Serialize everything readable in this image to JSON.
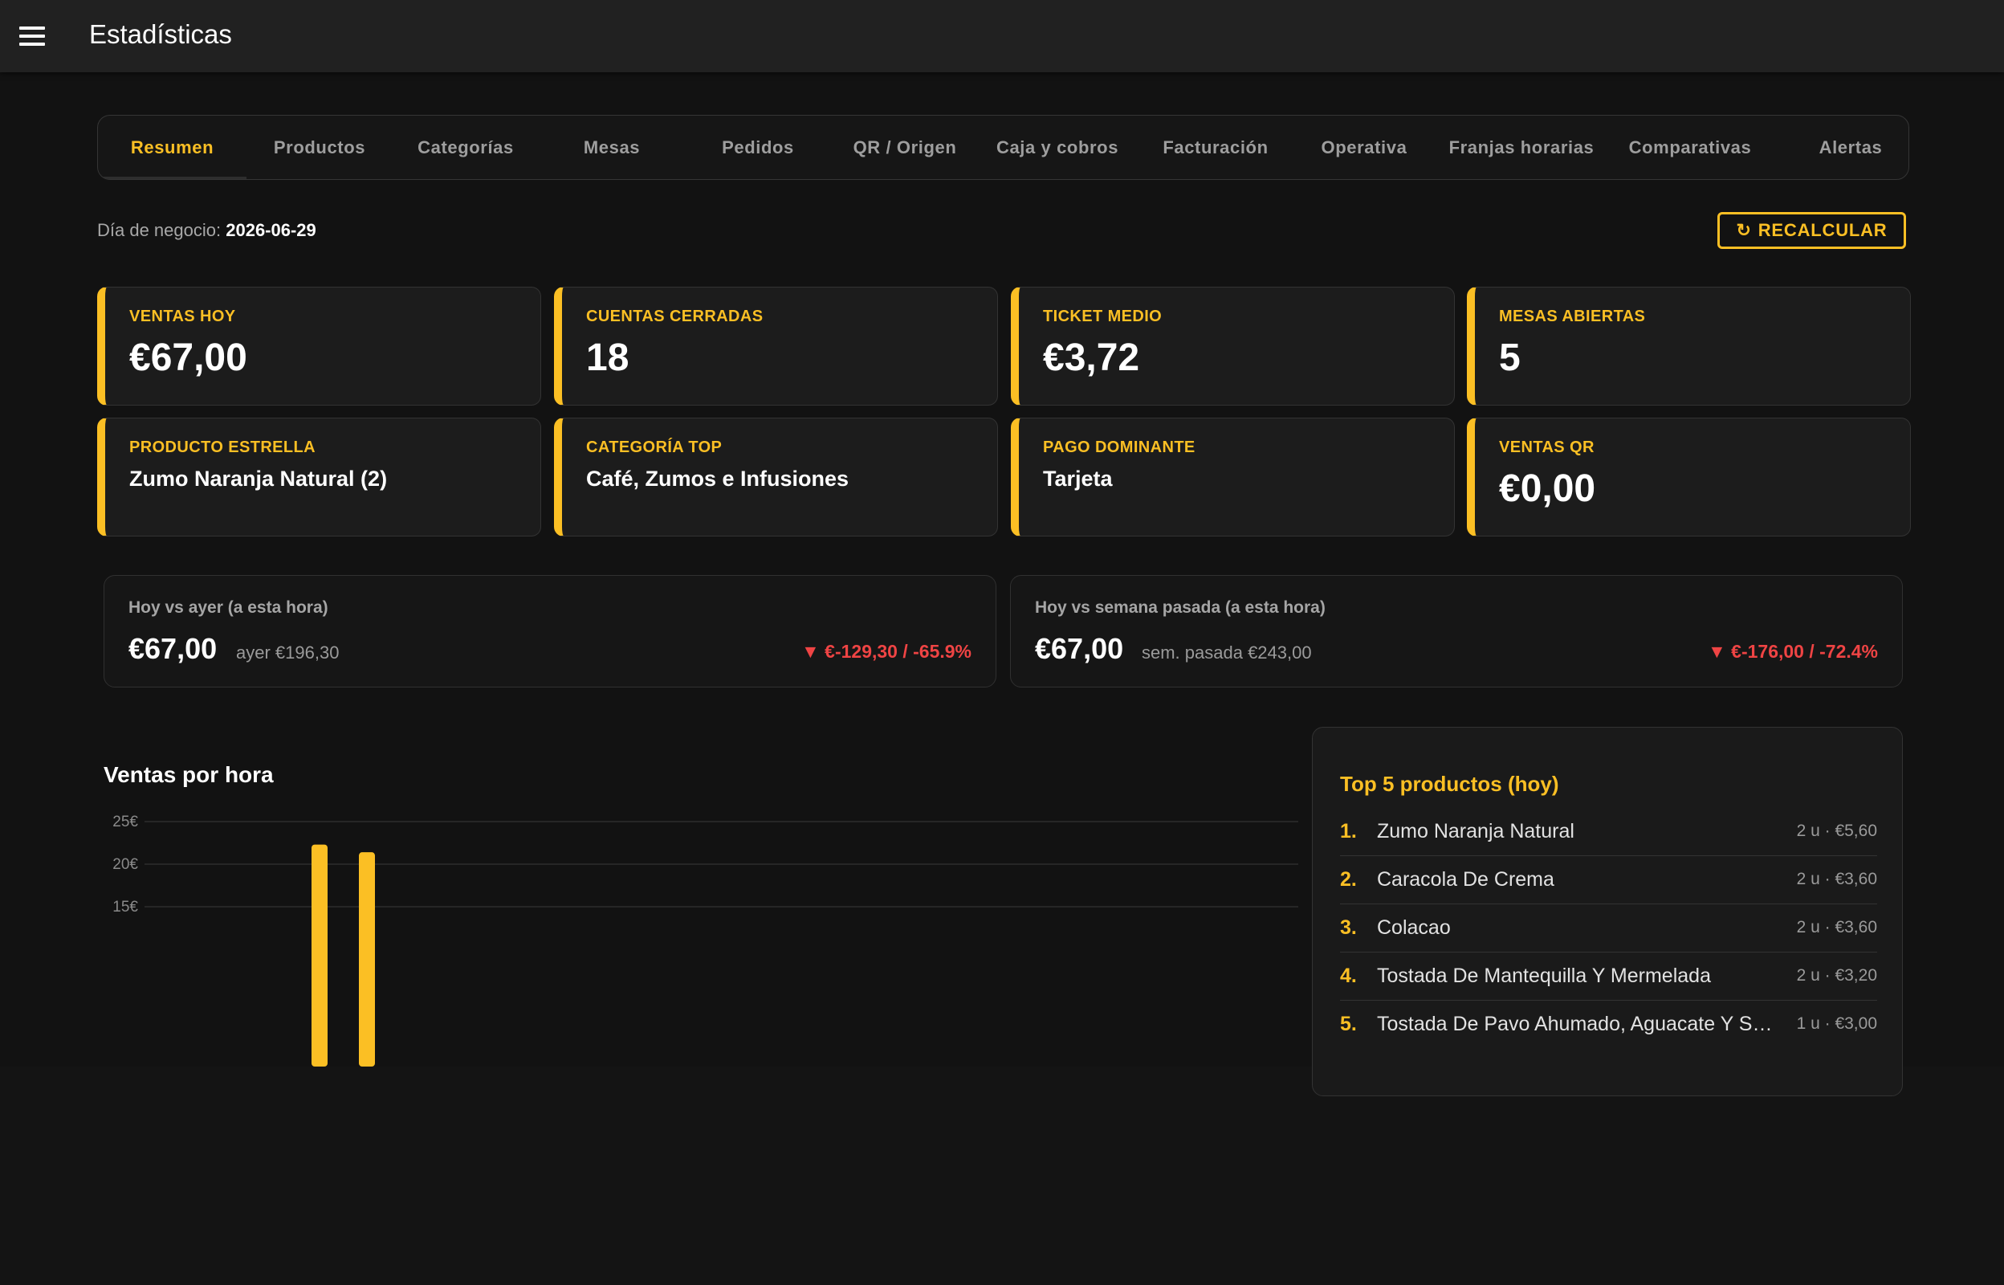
{
  "app": {
    "title": "Estadísticas"
  },
  "tabs": [
    {
      "label": "Resumen",
      "active": true
    },
    {
      "label": "Productos"
    },
    {
      "label": "Categorías"
    },
    {
      "label": "Mesas"
    },
    {
      "label": "Pedidos"
    },
    {
      "label": "QR / Origen"
    },
    {
      "label": "Caja y cobros"
    },
    {
      "label": "Facturación"
    },
    {
      "label": "Operativa"
    },
    {
      "label": "Franjas horarias"
    },
    {
      "label": "Comparativas"
    },
    {
      "label": "Alertas"
    }
  ],
  "business_day": {
    "label": "Día de negocio:",
    "value": "2026-06-29"
  },
  "recalc": {
    "icon": "refresh-icon",
    "glyph": "↻",
    "label": "RECALCULAR"
  },
  "kpis": [
    {
      "label": "VENTAS HOY",
      "value": "€67,00"
    },
    {
      "label": "CUENTAS CERRADAS",
      "value": "18"
    },
    {
      "label": "TICKET MEDIO",
      "value": "€3,72"
    },
    {
      "label": "MESAS ABIERTAS",
      "value": "5"
    },
    {
      "label": "PRODUCTO ESTRELLA",
      "value": "Zumo Naranja Natural (2)"
    },
    {
      "label": "CATEGORÍA TOP",
      "value": "Café, Zumos e Infusiones"
    },
    {
      "label": "PAGO DOMINANTE",
      "value": "Tarjeta"
    },
    {
      "label": "VENTAS QR",
      "value": "€0,00"
    }
  ],
  "comparisons": [
    {
      "label": "Hoy vs ayer (a esta hora)",
      "now": "€67,00",
      "prev": "ayer €196,30",
      "delta": "▼ €-129,30 / -65.9%"
    },
    {
      "label": "Hoy vs semana pasada (a esta hora)",
      "now": "€67,00",
      "prev": "sem. pasada €243,00",
      "delta": "▼ €-176,00 / -72.4%"
    }
  ],
  "chart_data": {
    "type": "bar",
    "title": "Ventas por hora",
    "y_ticks": [
      "25€",
      "20€",
      "15€"
    ],
    "ylim": [
      0,
      25
    ],
    "series": [
      {
        "values": [
          22.3,
          21.4
        ]
      }
    ],
    "color": "#fbbf24",
    "grid": true
  },
  "top5": {
    "title": "Top 5 productos (hoy)",
    "items": [
      {
        "rank": "1.",
        "name": "Zumo Naranja Natural",
        "meta": "2 u · €5,60"
      },
      {
        "rank": "2.",
        "name": "Caracola De Crema",
        "meta": "2 u · €3,60"
      },
      {
        "rank": "3.",
        "name": "Colacao",
        "meta": "2 u · €3,60"
      },
      {
        "rank": "4.",
        "name": "Tostada De Mantequilla Y Mermelada",
        "meta": "2 u · €3,20"
      },
      {
        "rank": "5.",
        "name": "Tostada De Pavo Ahumado, Aguacate Y Sésamo",
        "meta": "1 u · €3,00"
      }
    ]
  },
  "colors": {
    "accent": "#fbbf24",
    "negative": "#ef4444",
    "background": "#121212",
    "card": "#1c1c1c"
  }
}
